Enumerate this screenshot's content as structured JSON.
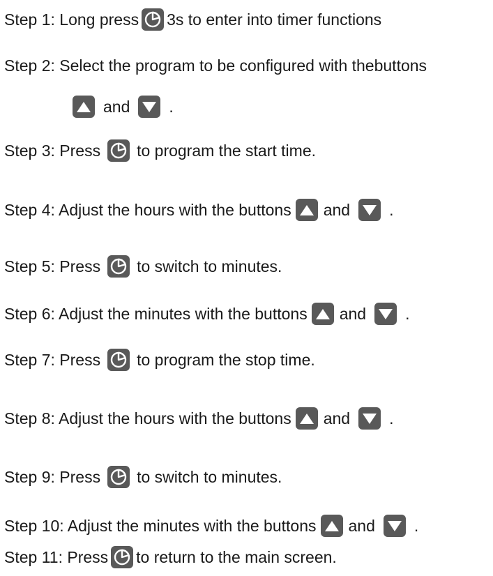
{
  "steps": {
    "s1": {
      "a": "Step 1:  Long press",
      "b": "3s to enter into timer functions"
    },
    "s2": {
      "a": "Step 2:  Select the program to be configured with thebuttons"
    },
    "s2b": {
      "and": "and",
      "end": "."
    },
    "s3": {
      "a": "Step 3: Press",
      "b": "to program the start time."
    },
    "s4": {
      "a": "Step 4:  Adjust the hours with the buttons",
      "and": "and",
      "end": "."
    },
    "s5": {
      "a": "Step 5: Press",
      "b": "to switch to minutes."
    },
    "s6": {
      "a": "Step 6: Adjust the minutes with the buttons",
      "and": "and",
      "end": "."
    },
    "s7": {
      "a": "Step 7: Press",
      "b": "to program the stop time."
    },
    "s8": {
      "a": "Step 8:  Adjust the hours with the buttons",
      "and": "and",
      "end": "."
    },
    "s9": {
      "a": "Step 9: Press",
      "b": "to switch to minutes."
    },
    "s10": {
      "a": "Step 10: Adjust the minutes with the buttons",
      "and": "and",
      "end": "."
    },
    "s11": {
      "a": "Step 11:  Press",
      "b": "to return to the main screen."
    }
  },
  "icons": {
    "timer": "timer-clock-icon",
    "up": "up-arrow-icon",
    "down": "down-arrow-icon"
  },
  "colors": {
    "button_bg": "#595959",
    "text": "#1a1a1a"
  }
}
